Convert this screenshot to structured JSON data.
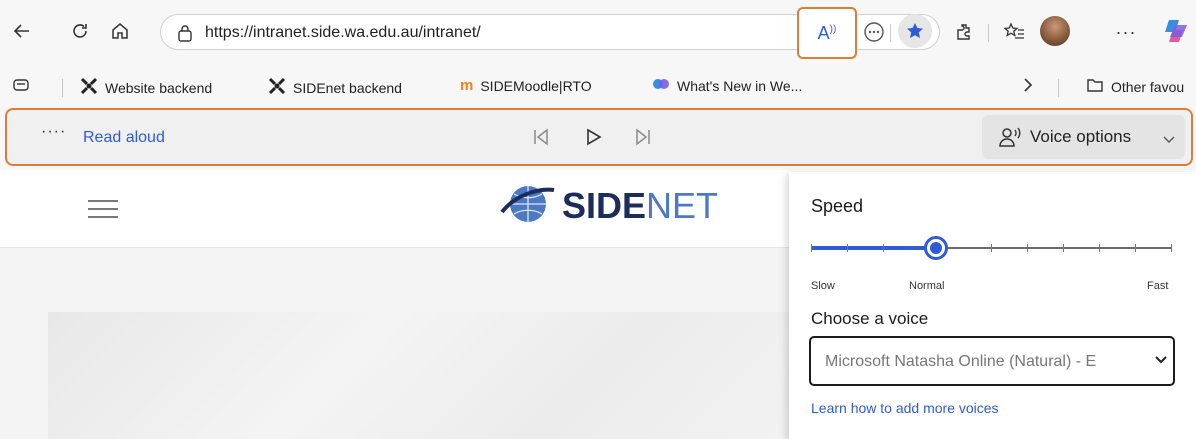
{
  "browser": {
    "url": "https://intranet.side.wa.edu.au/intranet/",
    "toolbar_icons": [
      "read-aloud-icon",
      "more-icon",
      "favorite-star-icon",
      "extensions-icon",
      "favorites-icon",
      "profile-avatar",
      "more-options-icon",
      "copilot-icon"
    ]
  },
  "bookmarks": {
    "items": [
      {
        "label": "Website backend",
        "icon": "joomla-icon"
      },
      {
        "label": "SIDEnet backend",
        "icon": "joomla-icon"
      },
      {
        "label": "SIDEMoodle|RTO",
        "icon": "moodle-icon"
      },
      {
        "label": "What's New in We...",
        "icon": "copilot-icon"
      }
    ],
    "other": "Other favou"
  },
  "read_aloud": {
    "label": "Read aloud",
    "voice_options": "Voice options"
  },
  "page": {
    "logo_main": "SIDE",
    "logo_net": "NET"
  },
  "voice_panel": {
    "speed_label": "Speed",
    "speed_level": 0.33,
    "scale": {
      "slow": "Slow",
      "normal": "Normal",
      "fast": "Fast"
    },
    "choose_label": "Choose a voice",
    "selected_voice": "Microsoft Natasha Online (Natural) - E",
    "learn_link": "Learn how to add more voices"
  },
  "colors": {
    "accent": "#2f5bd6",
    "highlight": "#e07b39"
  }
}
